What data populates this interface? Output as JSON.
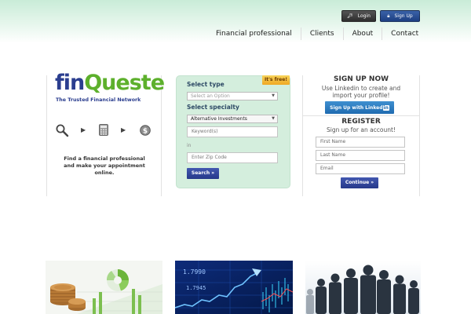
{
  "header": {
    "login_label": "Login",
    "signup_label": "Sign Up",
    "nav": [
      "Financial professional",
      "Clients",
      "About",
      "Contact"
    ]
  },
  "brand": {
    "logo_part1": "fin",
    "logo_part2": "Queste",
    "tagline": "The Trusted Financial Network"
  },
  "steps": {
    "icons": [
      "search-icon",
      "arrow-right-icon",
      "calculator-icon",
      "arrow-right-icon",
      "dollar-coin-icon"
    ],
    "description": "Find a financial professional and make your appointment online."
  },
  "search": {
    "badge": "It's free!",
    "type_label": "Select type",
    "type_value": "Select an Option",
    "specialty_label": "Select specialty",
    "specialty_value": "Alternative Investments",
    "keyword_placeholder": "Keyword(s)",
    "in_label": "in",
    "zip_placeholder": "Enter Zip Code",
    "button_label": "Search »"
  },
  "signup": {
    "title": "SIGN UP NOW",
    "subtitle": "Use Linkedin to create and import your profile!",
    "linkedin_label": "Sign Up with",
    "linkedin_badge_text": "Linked",
    "linkedin_badge_in": "in"
  },
  "register": {
    "title": "REGISTER",
    "subtitle": "Sign up for an account!",
    "first_name_placeholder": "First Name",
    "last_name_placeholder": "Last Name",
    "email_placeholder": "Email",
    "continue_label": "Continue »"
  },
  "thumbnails": {
    "stock_ticker_1": "1.7990",
    "stock_ticker_2": "1.7945"
  },
  "colors": {
    "brand_blue": "#2b3e8f",
    "brand_green": "#5db02c",
    "panel_green": "#d4eedd",
    "button_blue": "#26398a",
    "linkedin_blue": "#1f6bb0"
  }
}
